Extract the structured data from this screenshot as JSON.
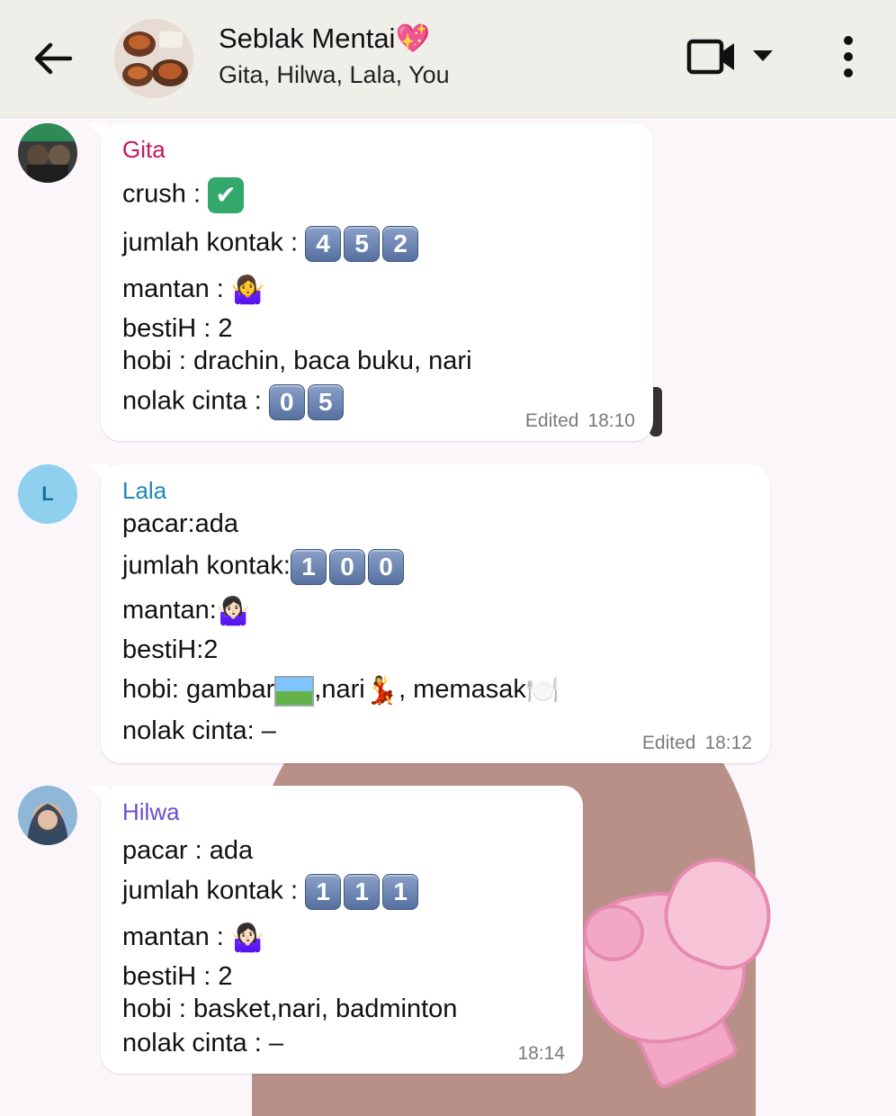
{
  "header": {
    "title": "Seblak Mentai💖",
    "subtitle": "Gita, Hilwa, Lala, You"
  },
  "messages": [
    {
      "sender": "Gita",
      "sender_color": "#c2185b",
      "lines": [
        "crush : ",
        "jumlah kontak : ",
        "mantan : ",
        "bestiH : 2",
        "hobi : drachin, baca buku, nari",
        "nolak cinta : "
      ],
      "keycaps": {
        "kontak": [
          "4",
          "5",
          "2"
        ],
        "nolak": [
          "0",
          "5"
        ]
      },
      "edited": "Edited",
      "time": "18:10"
    },
    {
      "sender": "Lala",
      "avatar_letter": "L",
      "sender_color": "#1f87b8",
      "lines": [
        "pacar:ada",
        "jumlah kontak:",
        "mantan:",
        "bestiH:2",
        "hobi: gambar",
        ",nari",
        ", memasak",
        "nolak cinta: –"
      ],
      "keycaps": {
        "kontak": [
          "1",
          "0",
          "0"
        ]
      },
      "edited": "Edited",
      "time": "18:12"
    },
    {
      "sender": "Hilwa",
      "sender_color": "#6a4fd1",
      "lines": [
        "pacar : ada",
        "jumlah kontak : ",
        "mantan : ",
        "bestiH : 2",
        "hobi : basket,nari, badminton",
        "nolak cinta : –"
      ],
      "keycaps": {
        "kontak": [
          "1",
          "1",
          "1"
        ]
      },
      "time": "18:14"
    }
  ]
}
